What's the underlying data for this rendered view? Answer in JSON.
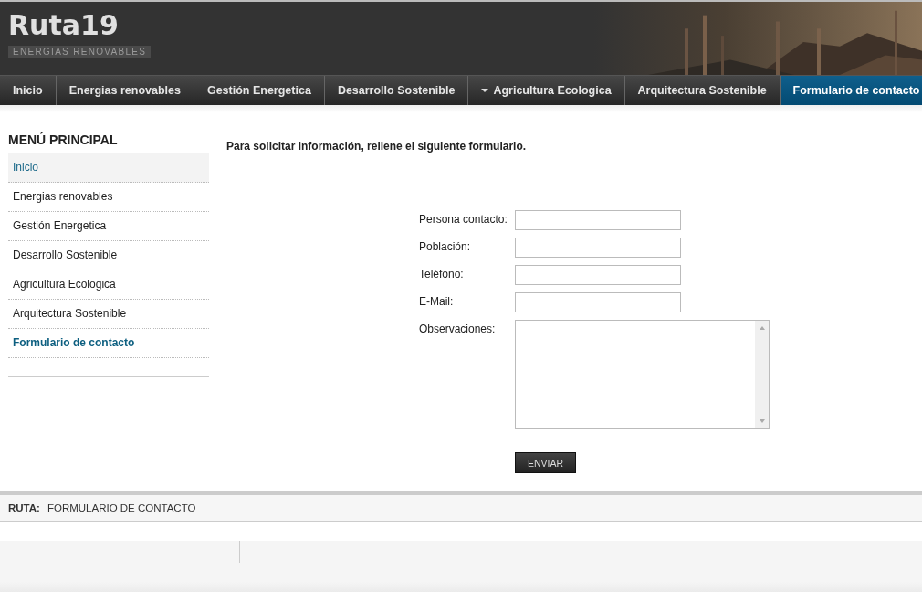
{
  "site": {
    "title": "Ruta19",
    "tagline": "ENERGIAS RENOVABLES"
  },
  "nav": [
    {
      "label": "Inicio",
      "kind": "link",
      "selected": false
    },
    {
      "label": "Energias renovables",
      "kind": "link",
      "selected": false
    },
    {
      "label": "Gestión Energetica",
      "kind": "link",
      "selected": false
    },
    {
      "label": "Desarrollo Sostenible",
      "kind": "link",
      "selected": false
    },
    {
      "label": "Agricultura Ecologica",
      "kind": "dropdown",
      "selected": false
    },
    {
      "label": "Arquitectura Sostenible",
      "kind": "link",
      "selected": false
    },
    {
      "label": "Formulario de contacto",
      "kind": "link",
      "selected": true
    }
  ],
  "sidebar": {
    "title": "MENÚ PRINCIPAL",
    "items": [
      {
        "label": "Inicio",
        "highlighted": true,
        "selected": false
      },
      {
        "label": "Energias renovables",
        "highlighted": false,
        "selected": false
      },
      {
        "label": "Gestión Energetica",
        "highlighted": false,
        "selected": false
      },
      {
        "label": "Desarrollo Sostenible",
        "highlighted": false,
        "selected": false
      },
      {
        "label": "Agricultura Ecologica",
        "highlighted": false,
        "selected": false
      },
      {
        "label": "Arquitectura Sostenible",
        "highlighted": false,
        "selected": false
      },
      {
        "label": "Formulario de contacto",
        "highlighted": false,
        "selected": true
      }
    ]
  },
  "form": {
    "intro": "Para solicitar información, rellene el siguiente formulario.",
    "fields": [
      {
        "label": "Persona contacto:",
        "kind": "text"
      },
      {
        "label": "Población:",
        "kind": "text"
      },
      {
        "label": "Teléfono:",
        "kind": "text"
      },
      {
        "label": "E-Mail:",
        "kind": "text"
      },
      {
        "label": "Observaciones:",
        "kind": "textarea"
      }
    ],
    "submit": "ENVIAR"
  },
  "breadcrumb": {
    "label": "RUTA:",
    "current": "FORMULARIO DE CONTACTO"
  }
}
